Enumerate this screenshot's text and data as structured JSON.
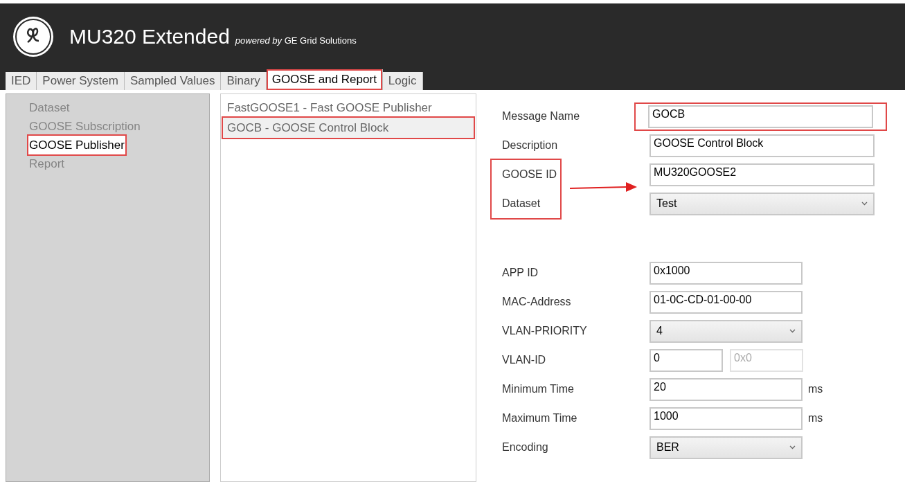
{
  "header": {
    "title": "MU320 Extended",
    "subtitle_prefix": "powered by",
    "subtitle": "GE Grid Solutions"
  },
  "tabs": [
    {
      "label": "IED",
      "selected": false,
      "highlighted": false
    },
    {
      "label": "Power System",
      "selected": false,
      "highlighted": false
    },
    {
      "label": "Sampled Values",
      "selected": false,
      "highlighted": false
    },
    {
      "label": "Binary",
      "selected": false,
      "highlighted": false
    },
    {
      "label": "GOOSE and Report",
      "selected": true,
      "highlighted": true
    },
    {
      "label": "Logic",
      "selected": false,
      "highlighted": false
    }
  ],
  "sidebar": {
    "items": [
      {
        "label": "Dataset",
        "selected": false,
        "highlighted": false
      },
      {
        "label": "GOOSE Subscription",
        "selected": false,
        "highlighted": false
      },
      {
        "label": "GOOSE Publisher",
        "selected": true,
        "highlighted": true
      },
      {
        "label": "Report",
        "selected": false,
        "highlighted": false
      }
    ]
  },
  "list": {
    "items": [
      {
        "label": "FastGOOSE1 - Fast GOOSE Publisher",
        "selected": false,
        "highlighted": false
      },
      {
        "label": "GOCB - GOOSE Control Block",
        "selected": true,
        "highlighted": true
      }
    ]
  },
  "form": {
    "label_arrow": true,
    "groups": [
      {
        "fields": [
          {
            "kind": "text",
            "label": "Message Name",
            "value": "GOCB",
            "input_highlighted": true,
            "label_highlighted": false
          },
          {
            "kind": "text",
            "label": "Description",
            "value": "GOOSE Control Block",
            "input_highlighted": false,
            "label_highlighted": false
          },
          {
            "kind": "text",
            "label": "GOOSE ID",
            "value": "MU320GOOSE2",
            "input_highlighted": false,
            "label_highlighted": true
          },
          {
            "kind": "select",
            "label": "Dataset",
            "value": "Test",
            "input_highlighted": false,
            "label_highlighted": true
          }
        ]
      },
      {
        "fields": [
          {
            "kind": "text",
            "label": "APP ID",
            "value": "0x1000",
            "input_highlighted": false,
            "label_highlighted": false
          },
          {
            "kind": "text",
            "label": "MAC-Address",
            "value": "01-0C-CD-01-00-00",
            "input_highlighted": false,
            "label_highlighted": false
          },
          {
            "kind": "select",
            "label": "VLAN-PRIORITY",
            "value": "4",
            "input_highlighted": false,
            "label_highlighted": false
          },
          {
            "kind": "pair",
            "label": "VLAN-ID",
            "value": "0",
            "value2": "0x0",
            "input_highlighted": false,
            "label_highlighted": false
          },
          {
            "kind": "text",
            "label": "Minimum Time",
            "value": "20",
            "unit": "ms",
            "input_highlighted": false,
            "label_highlighted": false
          },
          {
            "kind": "text",
            "label": "Maximum Time",
            "value": "1000",
            "unit": "ms",
            "input_highlighted": false,
            "label_highlighted": false
          },
          {
            "kind": "select",
            "label": "Encoding",
            "value": "BER",
            "input_highlighted": false,
            "label_highlighted": false
          }
        ]
      }
    ]
  }
}
